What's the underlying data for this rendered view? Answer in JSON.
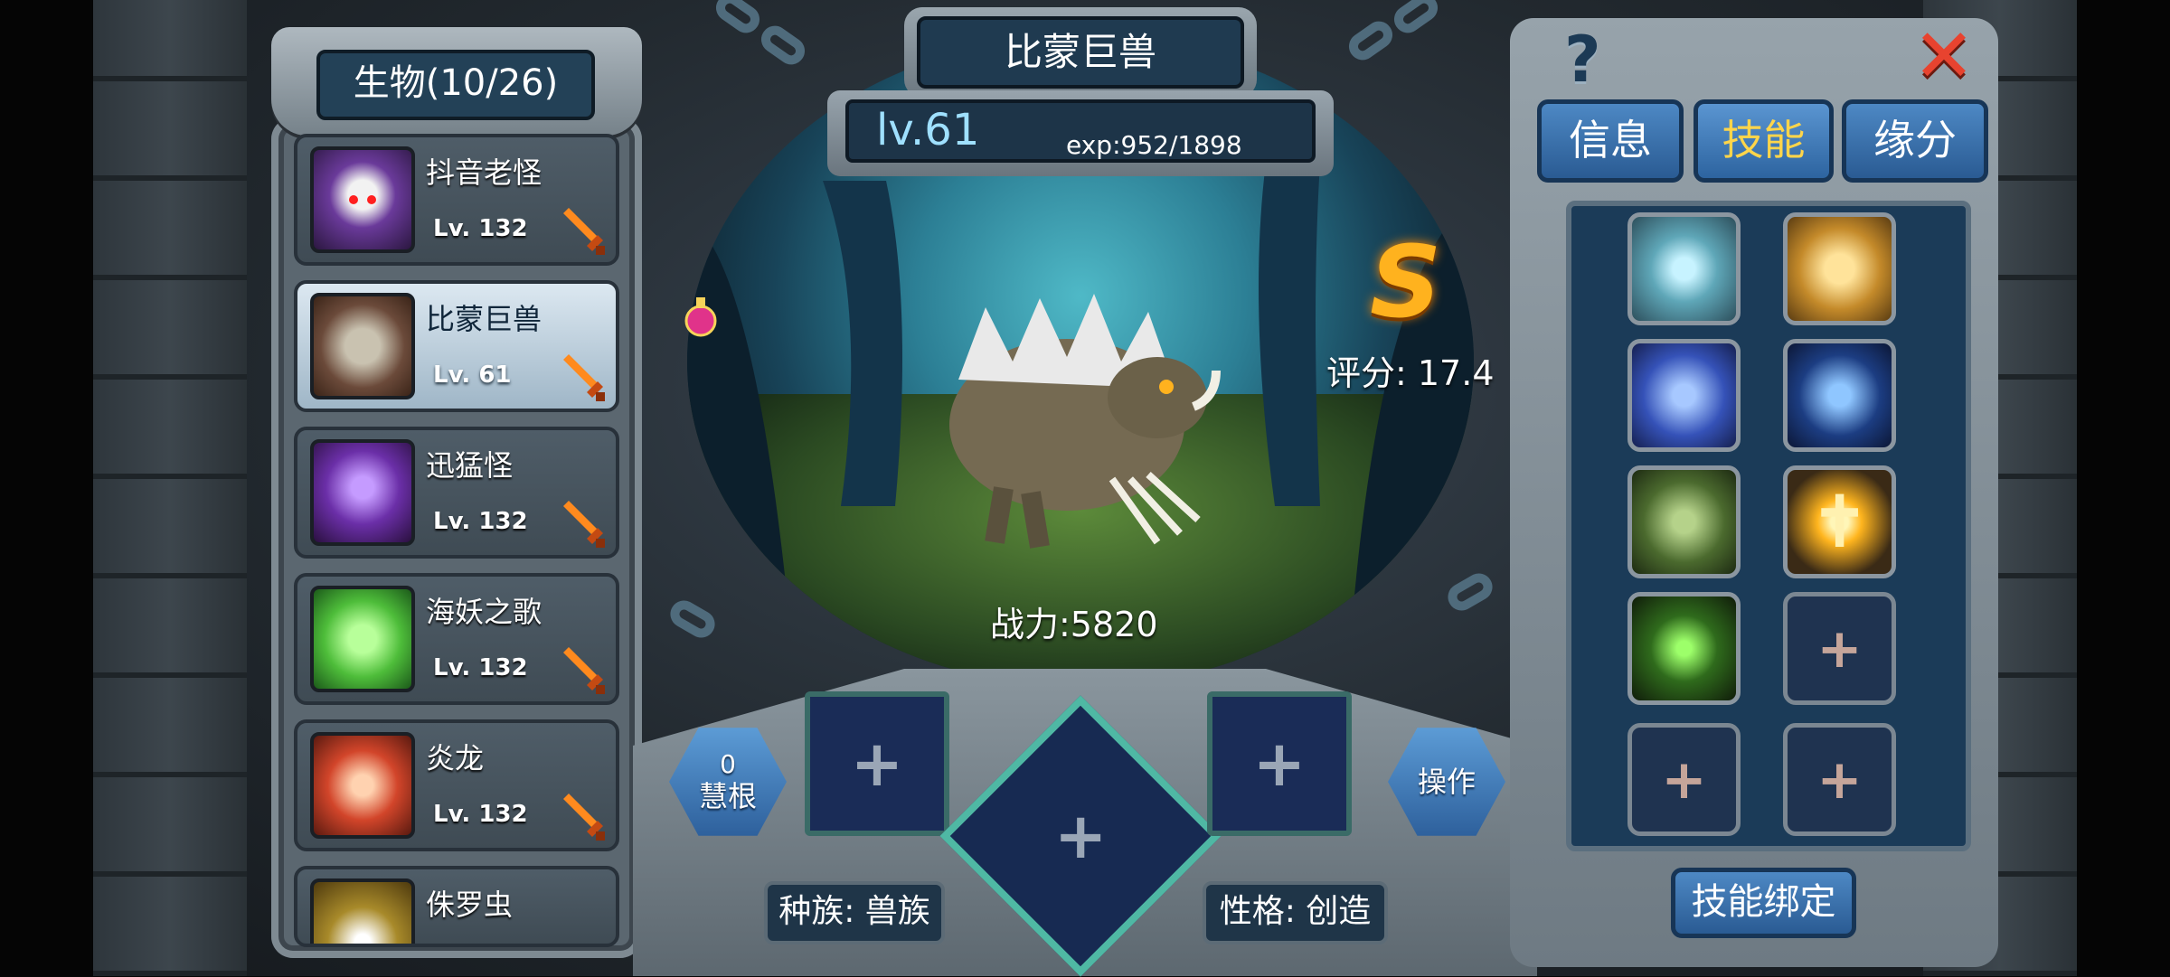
{
  "creature_list": {
    "title": "生物(10/26)",
    "items": [
      {
        "name": "抖音老怪",
        "level": "Lv. 132",
        "selected": false
      },
      {
        "name": "比蒙巨兽",
        "level": "Lv. 61",
        "selected": true
      },
      {
        "name": "迅猛怪",
        "level": "Lv. 132",
        "selected": false
      },
      {
        "name": "海妖之歌",
        "level": "Lv. 132",
        "selected": false
      },
      {
        "name": "炎龙",
        "level": "Lv. 132",
        "selected": false
      },
      {
        "name": "侏罗虫",
        "level": "",
        "selected": false
      }
    ]
  },
  "creature": {
    "name": "比蒙巨兽",
    "level": "lv.61",
    "exp": "exp:952/1898",
    "grade": "S",
    "score": "评分: 17.4",
    "power": "战力:5820"
  },
  "bottom": {
    "wisdom_count": "0",
    "wisdom_label": "慧根",
    "operate_label": "操作",
    "race": "种族: 兽族",
    "personality": "性格: 创造"
  },
  "tabs": [
    {
      "label": "信息",
      "active": false
    },
    {
      "label": "技能",
      "active": true
    },
    {
      "label": "缘分",
      "active": false
    }
  ],
  "skills": [
    {
      "icon": "crystal-skill-icon",
      "filled": true
    },
    {
      "icon": "golden-shield-skill-icon",
      "filled": true
    },
    {
      "icon": "blue-vortex-skill-icon",
      "filled": true
    },
    {
      "icon": "dark-figure-skill-icon",
      "filled": true
    },
    {
      "icon": "shadow-clones-skill-icon",
      "filled": true
    },
    {
      "icon": "holy-cross-skill-icon",
      "filled": true
    },
    {
      "icon": "green-beast-skill-icon",
      "filled": true
    },
    {
      "icon": "empty-slot",
      "filled": false
    },
    {
      "icon": "empty-slot",
      "filled": false
    },
    {
      "icon": "empty-slot",
      "filled": false
    }
  ],
  "skill_bind_label": "技能绑定",
  "colors": {
    "accent_tab_active": "#ffd54a",
    "close_red": "#e8432f",
    "grade_orange": "#ffb21e"
  }
}
